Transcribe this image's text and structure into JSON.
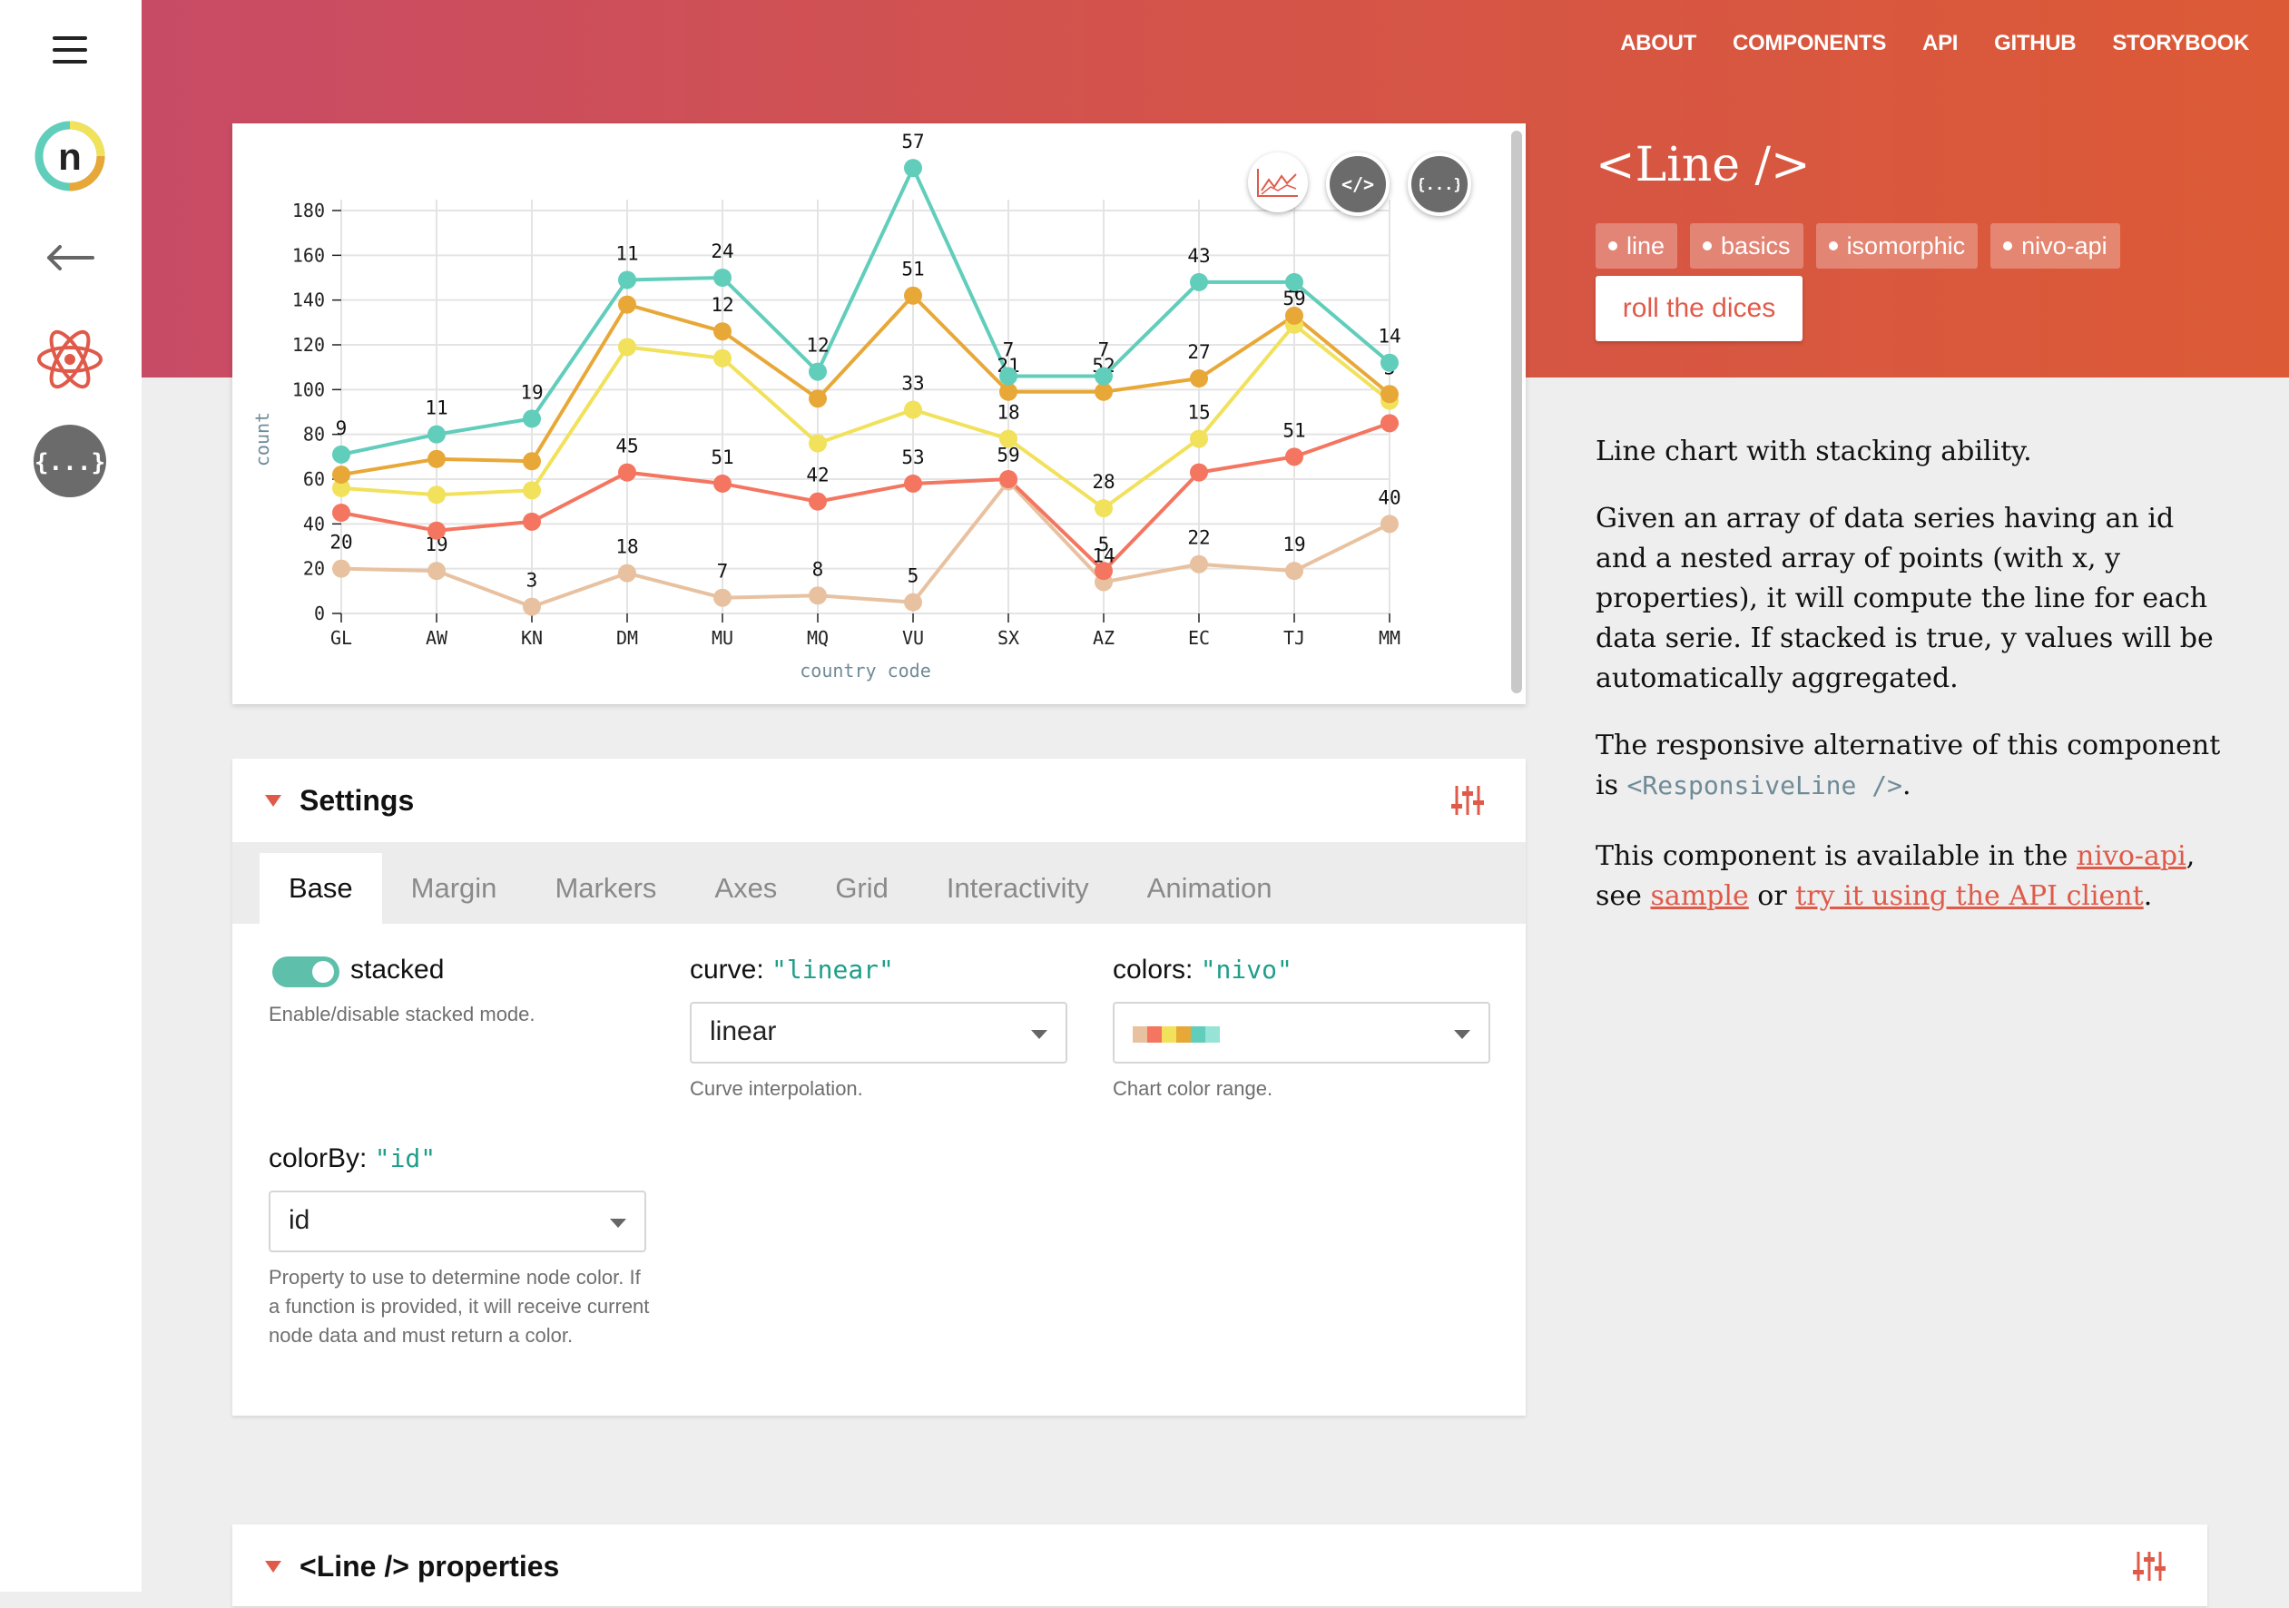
{
  "nav": {
    "links": [
      "ABOUT",
      "COMPONENTS",
      "API",
      "GITHUB",
      "STORYBOOK"
    ]
  },
  "sidebar": {
    "icons": [
      "menu-icon",
      "nivo-logo-icon",
      "back-arrow-icon",
      "react-icon",
      "json-icon"
    ]
  },
  "component": {
    "title": "<Line />",
    "tags": [
      "line",
      "basics",
      "isomorphic",
      "nivo-api"
    ],
    "roll_button": "roll the dices",
    "description": {
      "p1": "Line chart with stacking ability.",
      "p2": "Given an array of data series having an id and a nested array of points (with x, y properties), it will compute the line for each data serie.  If stacked is true, y values will be automatically aggregated.",
      "p3_prefix": "The responsive alternative of this component is ",
      "p3_code": "<ResponsiveLine />",
      "p3_suffix": ".",
      "p4_prefix": "This component is available in the ",
      "p4_link1": "nivo-api",
      "p4_mid1": ", see ",
      "p4_link2": "sample",
      "p4_mid2": " or ",
      "p4_link3": "try it using the API client",
      "p4_suffix": "."
    }
  },
  "chart_actions": [
    "line-chart-icon",
    "code-icon",
    "data-icon"
  ],
  "chart_data": {
    "type": "line",
    "stacked": true,
    "xlabel": "country code",
    "ylabel": "count",
    "ylim": [
      0,
      180
    ],
    "yticks": [
      0,
      20,
      40,
      60,
      80,
      100,
      120,
      140,
      160,
      180
    ],
    "categories": [
      "GL",
      "AW",
      "KN",
      "DM",
      "MU",
      "MQ",
      "VU",
      "SX",
      "AZ",
      "EC",
      "TJ",
      "MM"
    ],
    "series": [
      {
        "color": "#e8c1a0",
        "values": [
          20,
          19,
          3,
          18,
          7,
          8,
          5,
          59,
          14,
          22,
          19,
          40
        ],
        "labels": [
          "20",
          "19",
          "3",
          "18",
          "7",
          "8",
          "5",
          "59",
          "14",
          "22",
          "19",
          "40"
        ]
      },
      {
        "color": "#f47560",
        "values": [
          25,
          18,
          38,
          45,
          51,
          42,
          53,
          1,
          5,
          41,
          51,
          45
        ],
        "labels": [
          "",
          "",
          "",
          "45",
          "51",
          "42",
          "53",
          "",
          "5",
          "",
          "51",
          ""
        ]
      },
      {
        "color": "#f1e15b",
        "values": [
          11,
          16,
          14,
          56,
          56,
          26,
          33,
          18,
          28,
          15,
          59,
          10
        ],
        "labels": [
          "",
          "",
          "",
          "",
          "",
          "",
          "33",
          "18",
          "28",
          "15",
          "59",
          ""
        ]
      },
      {
        "color": "#e8a838",
        "values": [
          6,
          16,
          13,
          19,
          12,
          20,
          51,
          21,
          52,
          27,
          4,
          3
        ],
        "labels": [
          "",
          "",
          "",
          "",
          "12",
          "",
          "51",
          "21",
          "52",
          "27",
          "4",
          "3"
        ]
      },
      {
        "color": "#61cdbb",
        "values": [
          9,
          11,
          19,
          11,
          24,
          12,
          57,
          7,
          7,
          43,
          15,
          14
        ],
        "labels": [
          "9",
          "11",
          "19",
          "11",
          "24",
          "12",
          "57",
          "7",
          "7",
          "43",
          "",
          "14"
        ]
      }
    ]
  },
  "settings": {
    "title": "Settings",
    "tabs": [
      "Base",
      "Margin",
      "Markers",
      "Axes",
      "Grid",
      "Interactivity",
      "Animation"
    ],
    "stacked": {
      "label": "stacked",
      "help": "Enable/disable stacked mode."
    },
    "curve": {
      "label": "curve: ",
      "code": "\"linear\"",
      "value": "linear",
      "help": "Curve interpolation."
    },
    "colors": {
      "label": "colors: ",
      "code": "\"nivo\"",
      "help": "Chart color range.",
      "swatches": [
        "#e8c1a0",
        "#f47560",
        "#f1e15b",
        "#e8a838",
        "#61cdbb",
        "#97e3d5"
      ]
    },
    "colorBy": {
      "label": "colorBy: ",
      "code": "\"id\"",
      "value": "id",
      "help": "Property to use to determine node color. If a function is provided, it will receive current node data and must return a color."
    }
  },
  "properties": {
    "title": "<Line /> properties"
  }
}
